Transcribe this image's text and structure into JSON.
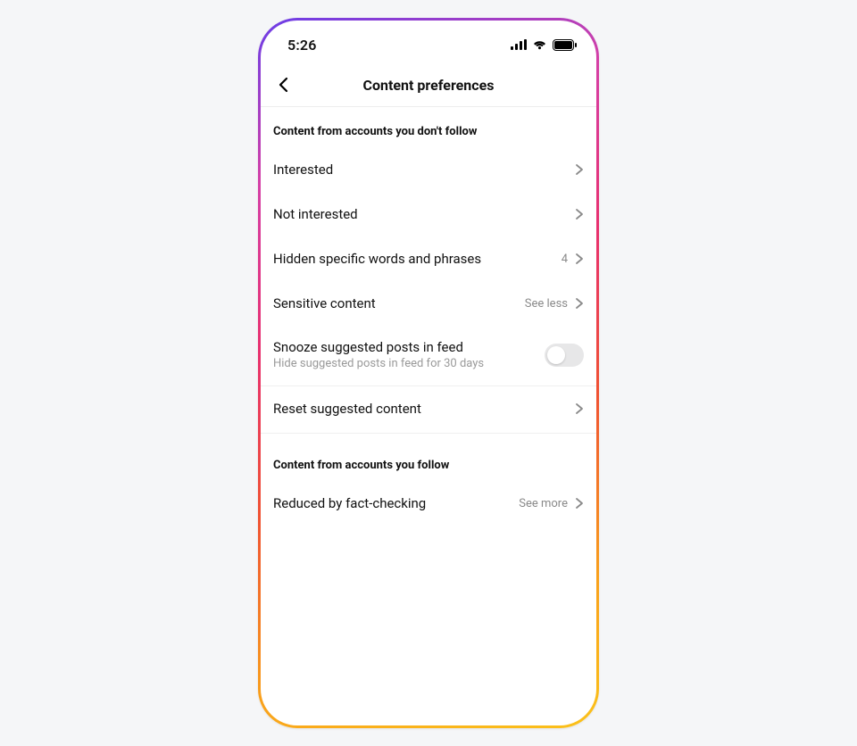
{
  "status": {
    "time": "5:26"
  },
  "nav": {
    "title": "Content preferences"
  },
  "section1": {
    "header": "Content from accounts you don't follow",
    "rows": {
      "interested": {
        "label": "Interested"
      },
      "not_interested": {
        "label": "Not interested"
      },
      "hidden_words": {
        "label": "Hidden specific words and phrases",
        "value": "4"
      },
      "sensitive": {
        "label": "Sensitive content",
        "value": "See less"
      },
      "snooze": {
        "label": "Snooze suggested posts in feed",
        "sublabel": "Hide suggested posts in feed for 30 days",
        "toggle": false
      },
      "reset": {
        "label": "Reset suggested content"
      }
    }
  },
  "section2": {
    "header": "Content from accounts you follow",
    "rows": {
      "fact_check": {
        "label": "Reduced by fact-checking",
        "value": "See more"
      }
    }
  }
}
